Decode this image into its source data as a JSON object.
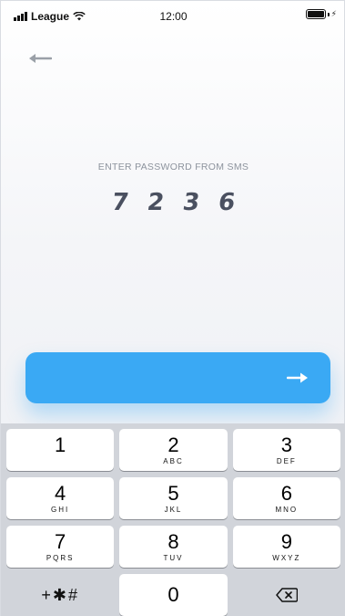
{
  "status_bar": {
    "carrier": "League",
    "time": "12:00",
    "bolt": "⚡"
  },
  "prompt": "ENTER PASSWORD FROM SMS",
  "code_digits": [
    "7",
    "2",
    "3",
    "6"
  ],
  "keypad": {
    "rows": [
      [
        {
          "digit": "1",
          "letters": ""
        },
        {
          "digit": "2",
          "letters": "ABC"
        },
        {
          "digit": "3",
          "letters": "DEF"
        }
      ],
      [
        {
          "digit": "4",
          "letters": "GHI"
        },
        {
          "digit": "5",
          "letters": "JKL"
        },
        {
          "digit": "6",
          "letters": "MNO"
        }
      ],
      [
        {
          "digit": "7",
          "letters": "PQRS"
        },
        {
          "digit": "8",
          "letters": "TUV"
        },
        {
          "digit": "9",
          "letters": "WXYZ"
        }
      ]
    ],
    "symbols_label": "+✱#",
    "zero": "0"
  },
  "colors": {
    "accent": "#3aa9f4",
    "code_text": "#4a5060",
    "prompt_text": "#8d939d",
    "keypad_bg": "#d1d4da"
  },
  "icons": {
    "back": "arrow-left-icon",
    "submit": "arrow-right-icon",
    "delete": "backspace-icon"
  }
}
